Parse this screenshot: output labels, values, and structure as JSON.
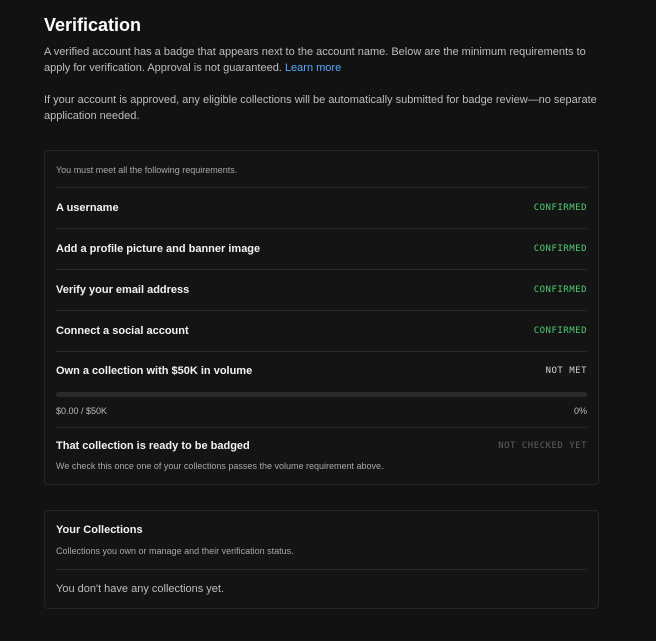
{
  "verification": {
    "title": "Verification",
    "description": "A verified account has a badge that appears next to the account name. Below are the minimum requirements to apply for verification. Approval is not guaranteed.",
    "learn_more": "Learn more",
    "auto_submit_note": "If your account is approved, any eligible collections will be automatically submitted for badge review—no separate application needed."
  },
  "requirements": {
    "intro": "You must meet all the following requirements.",
    "items": [
      {
        "label": "A username",
        "status": "CONFIRMED"
      },
      {
        "label": "Add a profile picture and banner image",
        "status": "CONFIRMED"
      },
      {
        "label": "Verify your email address",
        "status": "CONFIRMED"
      },
      {
        "label": "Connect a social account",
        "status": "CONFIRMED"
      }
    ],
    "volume": {
      "label": "Own a collection with $50K in volume",
      "status": "NOT MET",
      "progress_text": "$0.00 / $50K",
      "percent_text": "0%",
      "progress_fraction": 0
    },
    "badge_ready": {
      "label": "That collection is ready to be badged",
      "status": "NOT CHECKED YET",
      "note": "We check this once one of your collections passes the volume requirement above."
    }
  },
  "collections": {
    "title": "Your Collections",
    "subtitle": "Collections you own or manage and their verification status.",
    "empty_message": "You don't have any collections yet."
  },
  "colors": {
    "background": "#121212",
    "confirmed": "#4fcf74",
    "link": "#5ca9ff",
    "not_checked": "#5e5e5e"
  }
}
